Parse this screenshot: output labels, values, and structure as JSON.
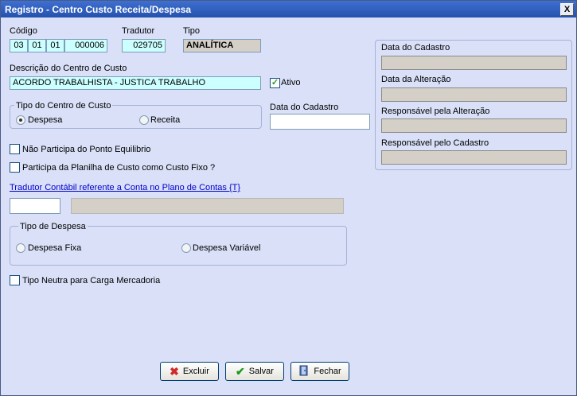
{
  "window": {
    "title": "Registro - Centro Custo Receita/Despesa",
    "close_glyph": "X"
  },
  "codigo": {
    "label": "Código",
    "parts": [
      "03",
      "01",
      "01",
      "000006"
    ]
  },
  "tradutor": {
    "label": "Tradutor",
    "value": "029705"
  },
  "tipo": {
    "label": "Tipo",
    "value": "ANALÍTICA"
  },
  "descricao": {
    "label": "Descrição do Centro de Custo",
    "value": "ACORDO TRABALHISTA - JUSTICA TRABALHO"
  },
  "ativo": {
    "label": "Ativo",
    "checked": true
  },
  "tipo_centro": {
    "legend": "Tipo do Centro de Custo",
    "options": [
      {
        "label": "Despesa",
        "selected": true
      },
      {
        "label": "Receita",
        "selected": false
      }
    ]
  },
  "data_cadastro_left": {
    "label": "Data do Cadastro",
    "value": ""
  },
  "nao_participa": {
    "label": "Não Participa do Ponto Equilibrio",
    "checked": false
  },
  "participa_planilha": {
    "label": "Participa da Planilha de Custo como Custo Fixo ?",
    "checked": false
  },
  "tradutor_contabil": {
    "link": "Tradutor Contábil referente a Conta no Plano de Contas {T}",
    "code": "",
    "description": ""
  },
  "tipo_despesa": {
    "legend": "Tipo de Despesa",
    "options": [
      {
        "label": "Despesa Fixa",
        "selected": false
      },
      {
        "label": "Despesa Variável",
        "selected": false
      }
    ]
  },
  "tipo_neutra": {
    "label": "Tipo Neutra para Carga Mercadoria",
    "checked": false
  },
  "audit": {
    "data_cadastro": "Data do Cadastro",
    "data_alteracao": "Data da Alteração",
    "resp_alteracao": "Responsável pela Alteração",
    "resp_cadastro": "Responsável pelo Cadastro"
  },
  "buttons": {
    "excluir": "Excluir",
    "salvar": "Salvar",
    "fechar": "Fechar"
  },
  "icons": {
    "excluir": "x-icon",
    "salvar": "check-icon",
    "fechar": "door-exit-icon"
  },
  "colors": {
    "titlebar": "#2451ad",
    "cyan_field": "#ccffff",
    "readonly_field": "#d4d0c8",
    "link": "#0000cc"
  }
}
